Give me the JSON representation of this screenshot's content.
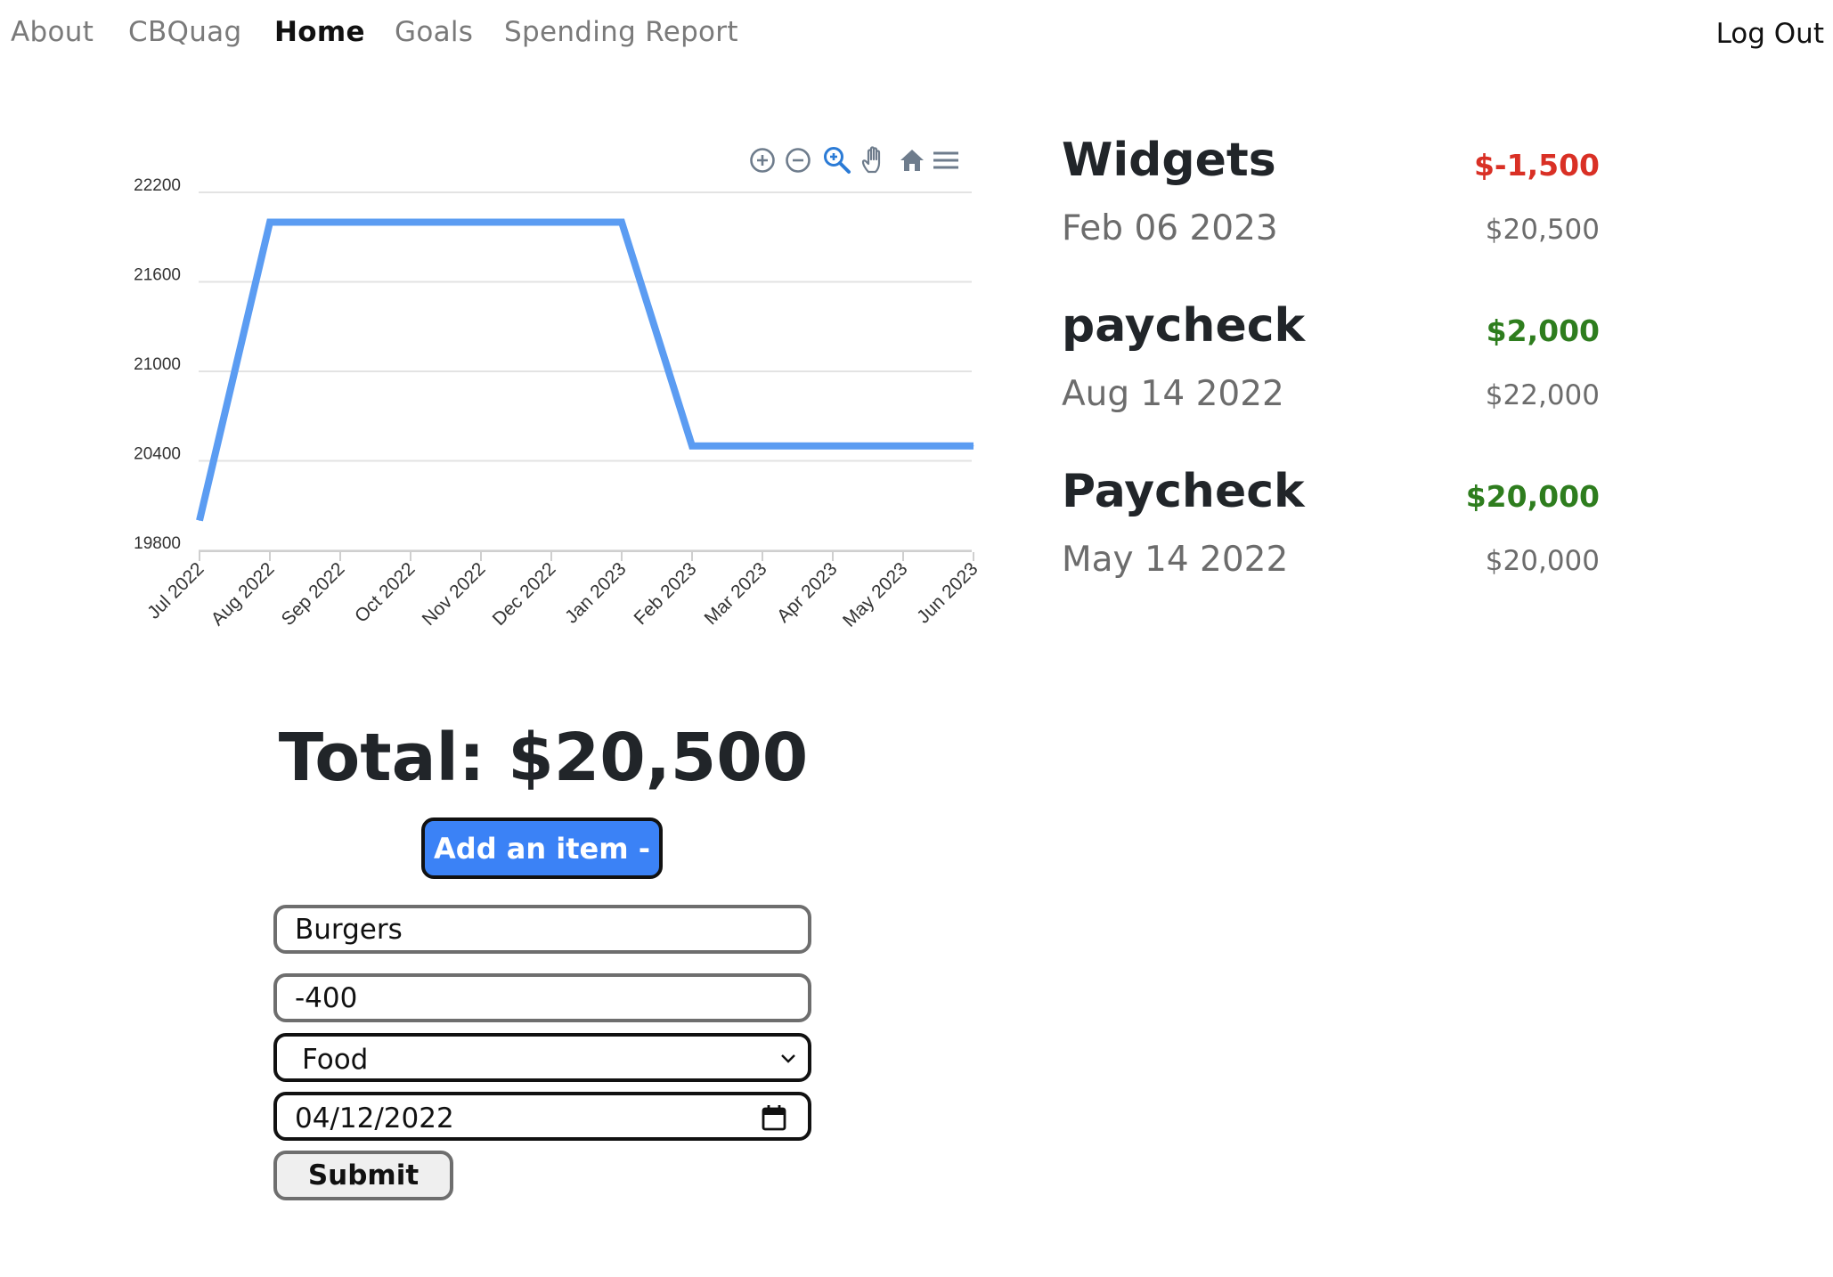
{
  "nav": {
    "items": [
      {
        "label": "About",
        "active": false
      },
      {
        "label": "CBQuag",
        "active": false
      },
      {
        "label": "Home",
        "active": true
      },
      {
        "label": "Goals",
        "active": false
      },
      {
        "label": "Spending Report",
        "active": false
      }
    ],
    "logout_label": "Log Out"
  },
  "chart_toolbar": {
    "icons": [
      "zoom-in-icon",
      "zoom-out-icon",
      "selection-zoom-icon",
      "pan-icon",
      "reset-home-icon",
      "menu-icon"
    ],
    "active_icon": "selection-zoom-icon",
    "icon_color": "#6e7c8c",
    "active_color": "#2b7bd6"
  },
  "chart_data": {
    "type": "line",
    "title": "",
    "xlabel": "",
    "ylabel": "",
    "x": [
      "Jul 2022",
      "Aug 2022",
      "Sep 2022",
      "Oct 2022",
      "Nov 2022",
      "Dec 2022",
      "Jan 2023",
      "Feb 2023",
      "Mar 2023",
      "Apr 2023",
      "May 2023",
      "Jun 2023"
    ],
    "series": [
      {
        "values": [
          20000,
          22000,
          22000,
          22000,
          22000,
          22000,
          22000,
          20500,
          20500,
          20500,
          20500,
          20500
        ],
        "color": "#5b9cf2"
      }
    ],
    "ylim": [
      19800,
      22200
    ],
    "yticks": [
      19800,
      20400,
      21000,
      21600,
      22200
    ],
    "grid": true,
    "legend": "none"
  },
  "transactions": [
    {
      "name": "Widgets",
      "amount": "$-1,500",
      "amount_color": "#d93025",
      "date": "Feb 06 2023",
      "balance": "$20,500"
    },
    {
      "name": "paycheck",
      "amount": "$2,000",
      "amount_color": "#2e7d1e",
      "date": "Aug 14 2022",
      "balance": "$22,000"
    },
    {
      "name": "Paycheck",
      "amount": "$20,000",
      "amount_color": "#2e7d1e",
      "date": "May 14 2022",
      "balance": "$20,000"
    }
  ],
  "total_text": "Total: $20,500",
  "form": {
    "toggle_label": "Add an item -",
    "name_value": "Burgers",
    "amount_value": "-400",
    "category_value": "Food",
    "date_value": "04/12/2022",
    "submit_label": "Submit"
  },
  "colors": {
    "accent_button": "#3b82f6",
    "line": "#5b9cf2",
    "negative": "#d93025",
    "positive": "#2e7d1e"
  }
}
